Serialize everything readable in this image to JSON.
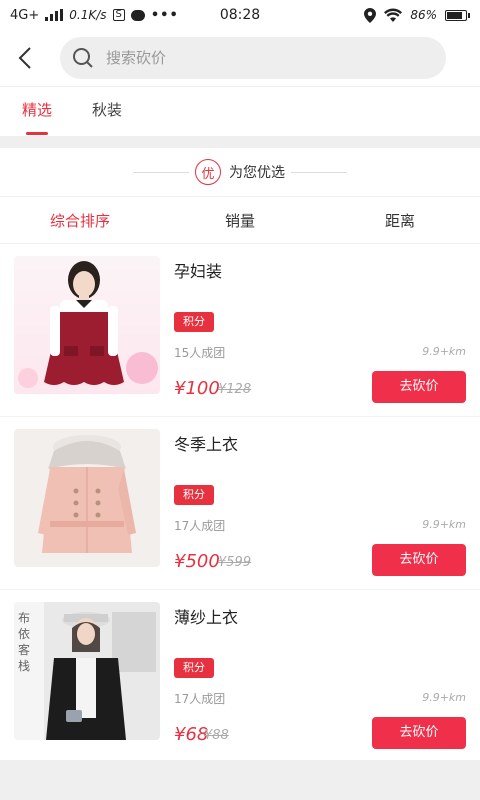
{
  "status_bar": {
    "network": "4G+",
    "speed": "0.1K/s",
    "time": "08:28",
    "battery": "86%",
    "battery_level": 0.86
  },
  "header": {
    "search_placeholder": "搜索砍价"
  },
  "tabs": [
    {
      "label": "精选",
      "active": true
    },
    {
      "label": "秋装",
      "active": false
    }
  ],
  "section": {
    "badge": "优",
    "title": "为您优选"
  },
  "sort": [
    {
      "label": "综合排序",
      "active": true
    },
    {
      "label": "销量",
      "active": false
    },
    {
      "label": "距离",
      "active": false
    }
  ],
  "products": [
    {
      "title": "孕妇装",
      "tag": "积分",
      "group": "15人成团",
      "distance": "9.9+km",
      "price": "¥100",
      "old_price": "¥128",
      "button": "去砍价",
      "image": "red-maternity-dress"
    },
    {
      "title": "冬季上衣",
      "tag": "积分",
      "group": "17人成团",
      "distance": "9.9+km",
      "price": "¥500",
      "old_price": "¥599",
      "button": "去砍价",
      "image": "pink-winter-coat"
    },
    {
      "title": "薄纱上衣",
      "tag": "积分",
      "group": "17人成团",
      "distance": "9.9+km",
      "price": "¥68",
      "old_price": "¥88",
      "button": "去砍价",
      "image": "black-cardigan-model"
    }
  ],
  "colors": {
    "accent": "#e8313f",
    "background": "#efefef"
  }
}
